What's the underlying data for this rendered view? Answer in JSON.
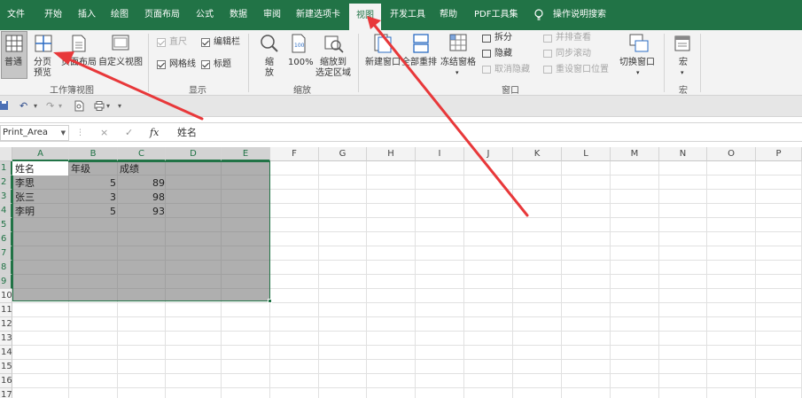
{
  "tabs": [
    "文件",
    "开始",
    "插入",
    "绘图",
    "页面布局",
    "公式",
    "数据",
    "审阅",
    "新建选项卡",
    "视图",
    "开发工具",
    "帮助",
    "PDF工具集"
  ],
  "active_tab": "视图",
  "tell_me": "操作说明搜索",
  "ribbon": {
    "workbook_views": {
      "normal": "普通",
      "page_break_preview": [
        "分页",
        "预览"
      ],
      "page_layout": "页面布局",
      "custom_views": "自定义视图",
      "title": "工作簿视图"
    },
    "show": {
      "ruler": "直尺",
      "formula_bar": "编辑栏",
      "gridlines": "网格线",
      "headings": "标题",
      "title": "显示"
    },
    "zoom": {
      "zoom": [
        "缩",
        "放"
      ],
      "hundred": "100%",
      "zoom_to_selection": [
        "缩放到",
        "选定区域"
      ],
      "title": "缩放"
    },
    "window": {
      "new_window": "新建窗口",
      "arrange_all": "全部重排",
      "freeze_panes": "冻结窗格",
      "split": "拆分",
      "hide": "隐藏",
      "unhide": "取消隐藏",
      "view_side_by_side": "并排查看",
      "synchronous_scrolling": "同步滚动",
      "reset_window_position": "重设窗口位置",
      "switch_windows": "切换窗口",
      "title": "窗口"
    },
    "macros": {
      "macros": "宏",
      "title": "宏"
    }
  },
  "formula_bar": {
    "name_box": "Print_Area",
    "cancel": "×",
    "enter": "✓",
    "fx": "fx",
    "content": "姓名"
  },
  "grid": {
    "columns": [
      "A",
      "B",
      "C",
      "D",
      "E",
      "F",
      "G",
      "H",
      "I",
      "J",
      "K",
      "L",
      "M",
      "N",
      "O",
      "P"
    ],
    "rows": [
      "1",
      "2",
      "3",
      "4",
      "5",
      "6",
      "7",
      "8",
      "9",
      "10",
      "11",
      "12",
      "13",
      "14",
      "15",
      "16",
      "17"
    ],
    "selection": "A1:E9",
    "cells": {
      "a1": "姓名",
      "b1": "年级",
      "c1": "成绩",
      "a2": "李思",
      "b2": "5",
      "c2": "89",
      "a3": "张三",
      "b3": "3",
      "c3": "98",
      "a4": "李明",
      "b4": "5",
      "c4": "93"
    }
  },
  "colors": {
    "accent": "#217346",
    "arrow": "#e8383a"
  }
}
